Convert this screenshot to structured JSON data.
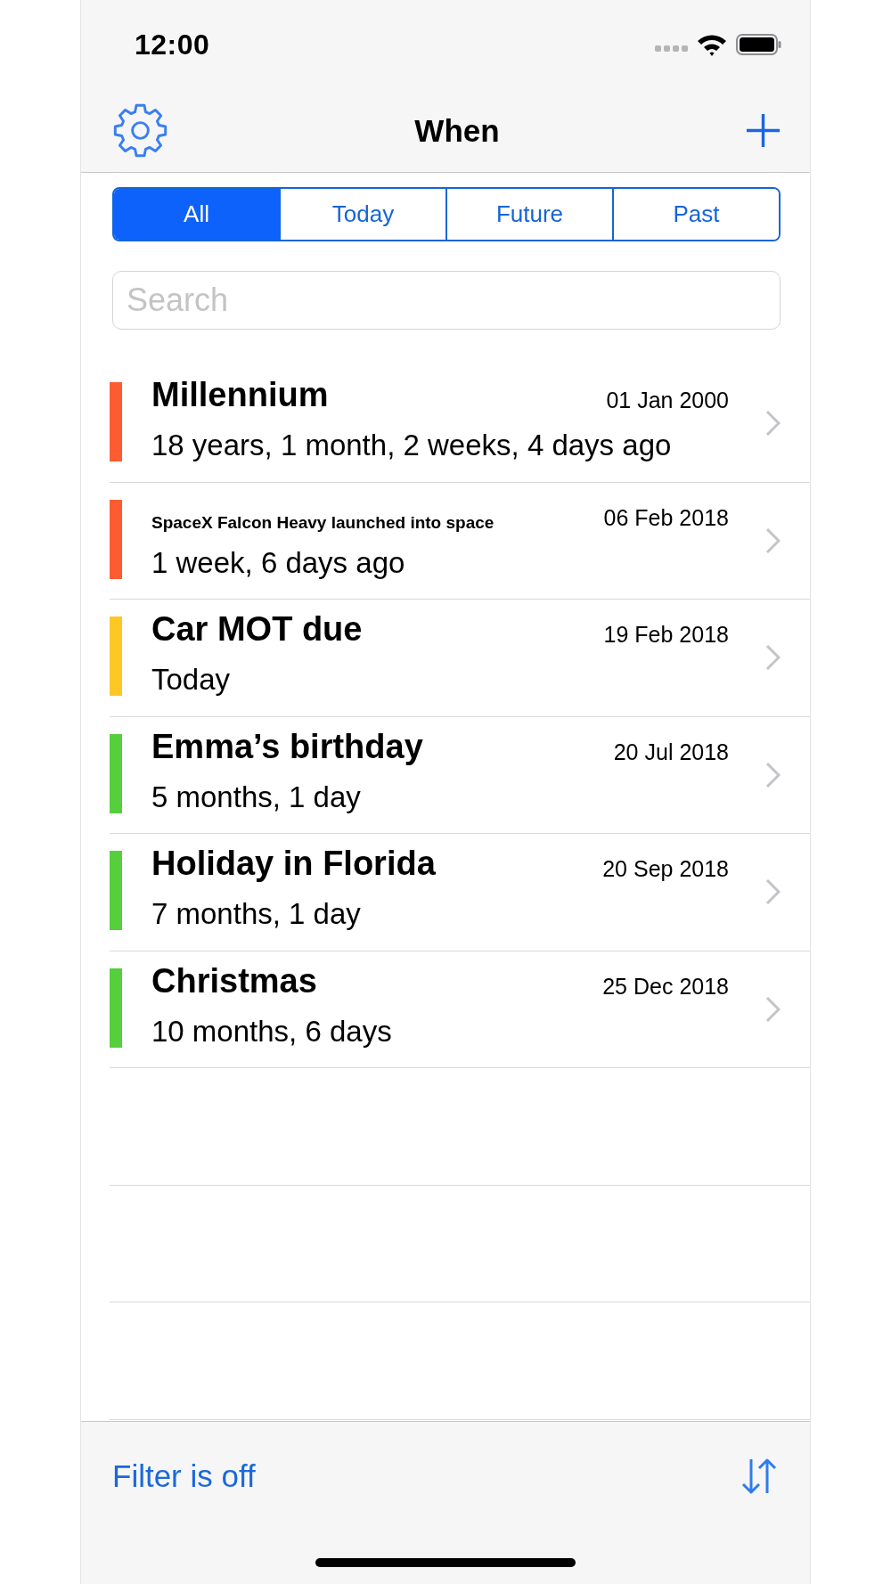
{
  "status_bar": {
    "time": "12:00"
  },
  "nav_bar": {
    "title": "When"
  },
  "segments": [
    {
      "label": "All",
      "selected": true
    },
    {
      "label": "Today",
      "selected": false
    },
    {
      "label": "Future",
      "selected": false
    },
    {
      "label": "Past",
      "selected": false
    }
  ],
  "search": {
    "placeholder": "Search"
  },
  "events": [
    {
      "title": "Millennium",
      "date": "01 Jan 2000",
      "relative": "18 years, 1 month, 2 weeks, 4 days ago",
      "color": "#fd5c31"
    },
    {
      "title": "SpaceX Falcon Heavy launched into space",
      "date": "06 Feb 2018",
      "relative": "1 week, 6 days ago",
      "color": "#fd5c31"
    },
    {
      "title": "Car MOT due",
      "date": "19 Feb 2018",
      "relative": "Today",
      "color": "#fdc824"
    },
    {
      "title": "Emma’s birthday",
      "date": "20 Jul 2018",
      "relative": "5 months, 1 day",
      "color": "#55cf3b"
    },
    {
      "title": "Holiday in Florida",
      "date": "20 Sep 2018",
      "relative": "7 months, 1 day",
      "color": "#55cf3b"
    },
    {
      "title": "Christmas",
      "date": "25 Dec 2018",
      "relative": "10 months, 6 days",
      "color": "#55cf3b"
    }
  ],
  "toolbar": {
    "filter_label": "Filter is off"
  }
}
